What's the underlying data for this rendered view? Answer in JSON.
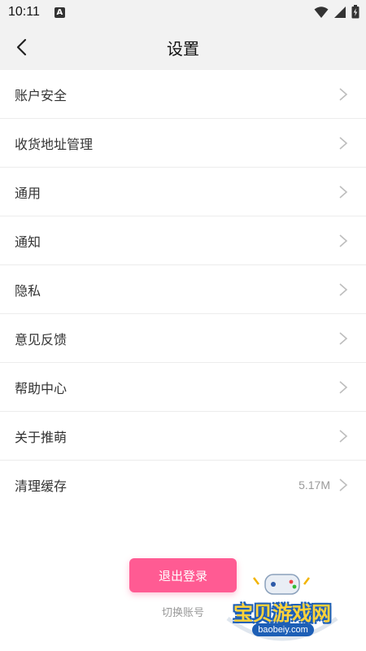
{
  "status_bar": {
    "time": "10:11",
    "notification_icon": "A"
  },
  "header": {
    "title": "设置"
  },
  "menu": {
    "items": [
      {
        "label": "账户安全",
        "value": ""
      },
      {
        "label": "收货地址管理",
        "value": ""
      },
      {
        "label": "通用",
        "value": ""
      },
      {
        "label": "通知",
        "value": ""
      },
      {
        "label": "隐私",
        "value": ""
      },
      {
        "label": "意见反馈",
        "value": ""
      },
      {
        "label": "帮助中心",
        "value": ""
      },
      {
        "label": "关于推萌",
        "value": ""
      },
      {
        "label": "清理缓存",
        "value": "5.17M"
      }
    ]
  },
  "actions": {
    "logout_label": "退出登录",
    "switch_account_label": "切换账号"
  },
  "watermark": {
    "text": "宝贝游戏网",
    "url": "baobeiy.com"
  },
  "colors": {
    "accent": "#ff5b93",
    "background": "#f4f4f4",
    "divider": "#ececec"
  }
}
